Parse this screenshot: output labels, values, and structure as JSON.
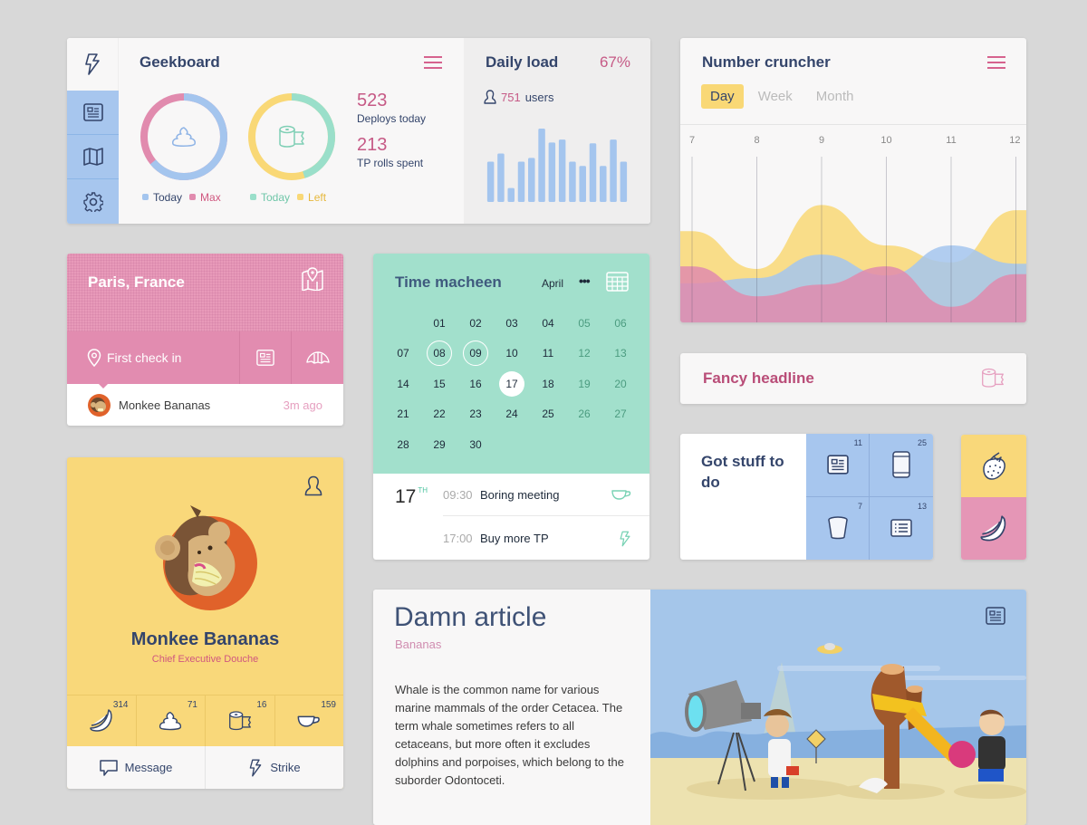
{
  "geekboard": {
    "title": "Geekboard",
    "nav": [
      {
        "icon": "lightning-icon"
      },
      {
        "icon": "news-icon"
      },
      {
        "icon": "map-icon"
      },
      {
        "icon": "gear-icon"
      }
    ],
    "donut1": {
      "icon": "poop-icon",
      "legend": [
        {
          "label": "Today",
          "color": "#a4c5ee"
        },
        {
          "label": "Max",
          "color": "#e18bae"
        }
      ],
      "today_fraction": 0.64
    },
    "donut2": {
      "icon": "toilet-paper-icon",
      "legend": [
        {
          "label": "Today",
          "color": "#9adfca"
        },
        {
          "label": "Left",
          "color": "#f9d876"
        }
      ],
      "today_fraction": 0.45
    },
    "stats": [
      {
        "value": "523",
        "label": "Deploys today"
      },
      {
        "value": "213",
        "label": "TP rolls spent"
      }
    ]
  },
  "daily_load": {
    "title": "Daily load",
    "percent": "67%",
    "users_count": "751",
    "users_label": "users",
    "bar_values": [
      55,
      66,
      19,
      55,
      60,
      100,
      81,
      85,
      55,
      49,
      80,
      49,
      85,
      55
    ]
  },
  "cruncher": {
    "title": "Number cruncher",
    "tabs": [
      {
        "label": "Day",
        "active": true
      },
      {
        "label": "Week",
        "active": false
      },
      {
        "label": "Month",
        "active": false
      }
    ]
  },
  "chart_data": {
    "type": "area",
    "title": "Number cruncher",
    "x": [
      7,
      8,
      9,
      10,
      11,
      12
    ],
    "xticklabels": [
      "7",
      "8",
      "9",
      "10",
      "11",
      "12"
    ],
    "ylim": [
      0,
      100
    ],
    "grid": "vertical",
    "series": [
      {
        "name": "yellow",
        "color": "#f9d876",
        "values": [
          70,
          41,
          90,
          59,
          46,
          86
        ]
      },
      {
        "name": "blue",
        "color": "#a4c5ee",
        "values": [
          30,
          34,
          52,
          36,
          59,
          45
        ]
      },
      {
        "name": "pink",
        "color": "#e18bae",
        "values": [
          43,
          20,
          29,
          43,
          12,
          37
        ]
      }
    ]
  },
  "checkin": {
    "city": "Paris, France",
    "label": "First check in",
    "user": "Monkee Bananas",
    "time": "3m ago"
  },
  "calendar": {
    "title": "Time macheen",
    "month": "April",
    "more": "•••",
    "days": [
      {
        "d": "",
        "t": ""
      },
      {
        "d": "01",
        "t": ""
      },
      {
        "d": "02",
        "t": ""
      },
      {
        "d": "03",
        "t": ""
      },
      {
        "d": "04",
        "t": ""
      },
      {
        "d": "05",
        "t": "we"
      },
      {
        "d": "06",
        "t": "we"
      },
      {
        "d": "07",
        "t": ""
      },
      {
        "d": "08",
        "t": "ring"
      },
      {
        "d": "09",
        "t": "ring"
      },
      {
        "d": "10",
        "t": ""
      },
      {
        "d": "11",
        "t": ""
      },
      {
        "d": "12",
        "t": "we"
      },
      {
        "d": "13",
        "t": "we"
      },
      {
        "d": "14",
        "t": ""
      },
      {
        "d": "15",
        "t": ""
      },
      {
        "d": "16",
        "t": ""
      },
      {
        "d": "17",
        "t": "sel"
      },
      {
        "d": "18",
        "t": ""
      },
      {
        "d": "19",
        "t": "we"
      },
      {
        "d": "20",
        "t": "we"
      },
      {
        "d": "21",
        "t": ""
      },
      {
        "d": "22",
        "t": ""
      },
      {
        "d": "23",
        "t": ""
      },
      {
        "d": "24",
        "t": ""
      },
      {
        "d": "25",
        "t": ""
      },
      {
        "d": "26",
        "t": "we"
      },
      {
        "d": "27",
        "t": "we"
      },
      {
        "d": "28",
        "t": ""
      },
      {
        "d": "29",
        "t": ""
      },
      {
        "d": "30",
        "t": ""
      }
    ],
    "selected_day": "17",
    "selected_suffix": "TH",
    "events": [
      {
        "time": "09:30",
        "title": "Boring meeting",
        "icon": "coffee-cup-icon"
      },
      {
        "time": "17:00",
        "title": "Buy more TP",
        "icon": "lightning-icon"
      }
    ]
  },
  "profile": {
    "name": "Monkee Bananas",
    "role": "Chief Executive Douche",
    "stats": [
      {
        "icon": "banana-icon",
        "count": "314"
      },
      {
        "icon": "poop-icon",
        "count": "71"
      },
      {
        "icon": "toilet-paper-icon",
        "count": "16"
      },
      {
        "icon": "coffee-cup-icon",
        "count": "159"
      }
    ],
    "actions": [
      {
        "label": "Message",
        "icon": "chat-bubble-icon"
      },
      {
        "label": "Strike",
        "icon": "lightning-icon"
      }
    ]
  },
  "fancy": {
    "title": "Fancy headline"
  },
  "todo": {
    "title": "Got stuff to do",
    "tiles": [
      {
        "icon": "news-icon",
        "count": "11"
      },
      {
        "icon": "phone-icon",
        "count": "25"
      },
      {
        "icon": "cup-icon",
        "count": "7"
      },
      {
        "icon": "list-icon",
        "count": "13"
      }
    ]
  },
  "article": {
    "title": "Damn article",
    "subtitle": "Bananas",
    "body": "Whale  is the common name for various marine mammals of the order Cetacea. The term whale sometimes refers to all cetaceans, but more often it excludes dolphins and porpoises, which belong to the suborder Odontoceti."
  }
}
